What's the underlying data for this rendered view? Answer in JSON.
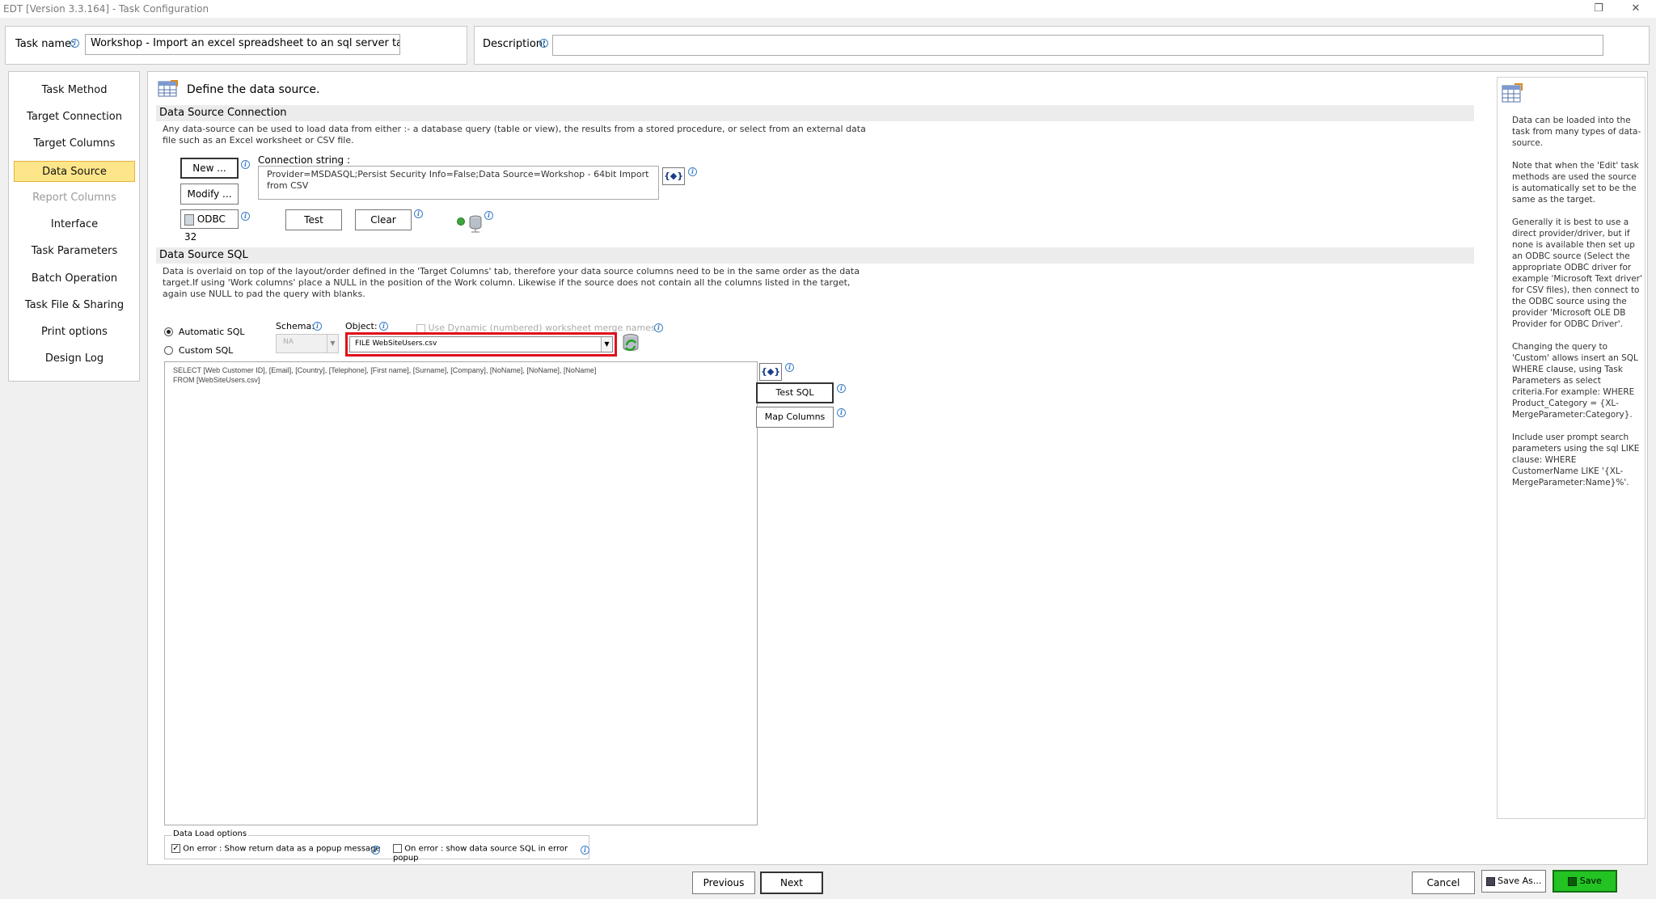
{
  "window": {
    "title": "EDT [Version 3.3.164] - Task Configuration"
  },
  "header": {
    "task_name_label": "Task name:",
    "task_name_value": "Workshop - Import an excel spreadsheet to an sql server table.",
    "description_label": "Description:",
    "description_value": ""
  },
  "sidebar": {
    "items": [
      {
        "label": "Task Method"
      },
      {
        "label": "Target Connection"
      },
      {
        "label": "Target Columns"
      },
      {
        "label": "Data Source"
      },
      {
        "label": "Report Columns"
      },
      {
        "label": "Interface"
      },
      {
        "label": "Task Parameters"
      },
      {
        "label": "Batch Operation"
      },
      {
        "label": "Task File & Sharing"
      },
      {
        "label": "Print options"
      },
      {
        "label": "Design Log"
      }
    ]
  },
  "main": {
    "page_title": "Define the data source.",
    "connection": {
      "heading": "Data Source Connection",
      "help": "Any data-source can be used to load data from either :- a database query (table or view), the results from a stored procedure, or select from an external data file such as an Excel worksheet or CSV file.",
      "new_label": "New ...",
      "modify_label": "Modify ...",
      "odbc_label": "ODBC 32",
      "conn_string_label": "Connection string :",
      "conn_string_value": "Provider=MSDASQL;Persist Security Info=False;Data Source=Workshop - 64bit Import from CSV",
      "test_label": "Test",
      "clear_label": "Clear",
      "param_symbol": "{◆}"
    },
    "sql": {
      "heading": "Data Source SQL",
      "help": "Data is overlaid on top of the layout/order defined in the 'Target Columns' tab,  therefore your data source columns need to be in the same order as the data target.If using 'Work columns' place a NULL in the position of the Work column.  Likewise if the source does not contain all the columns listed in the target, again use NULL to pad the query with blanks.",
      "auto_sql_label": "Automatic SQL",
      "custom_sql_label": "Custom SQL",
      "schema_label": "Schema:",
      "schema_value": "NA",
      "object_label": "Object:",
      "dynamic_label": "Use Dynamic (numbered) worksheet merge names",
      "object_value": "FILE WebSiteUsers.csv",
      "query_line1": "SELECT [Web Customer ID], [Email], [Country], [Telephone], [First name], [Surname], [Company], [NoName], [NoName], [NoName]",
      "query_line2": "FROM [WebSiteUsers.csv]",
      "test_sql_label": "Test SQL",
      "map_columns_label": "Map Columns",
      "param_symbol": "{◆}"
    },
    "load_options": {
      "legend": "Data Load options",
      "opt1": "On error : Show return data as a popup message",
      "opt2": "On error : show data source SQL in error popup"
    }
  },
  "help_panel": {
    "p1": "Data can be loaded into the task from many types of data-source.",
    "p2": "Note that when the 'Edit' task methods are used the source is automatically set to be the same as the target.",
    "p3": "Generally it is best to use a direct provider/driver, but if none is available then set up an ODBC source (Select the appropriate ODBC driver for example 'Microsoft Text driver' for CSV files), then connect to the ODBC source using the provider 'Microsoft OLE DB Provider for ODBC Driver'.",
    "p4": "Changing the query to 'Custom' allows insert an SQL WHERE clause, using Task Parameters as select criteria.For example: WHERE Product_Category = {XL-MergeParameter:Category}.",
    "p5": "Include user prompt search parameters using the sql LIKE clause: WHERE CustomerName LIKE '{XL-MergeParameter:Name}%'."
  },
  "footer": {
    "previous_label": "Previous",
    "next_label": "Next",
    "cancel_label": "Cancel",
    "save_as_label": "Save As...",
    "save_label": "Save"
  },
  "colors": {
    "active_nav": "#fde68a",
    "highlight": "#e0101a",
    "save_button": "#22c322"
  }
}
